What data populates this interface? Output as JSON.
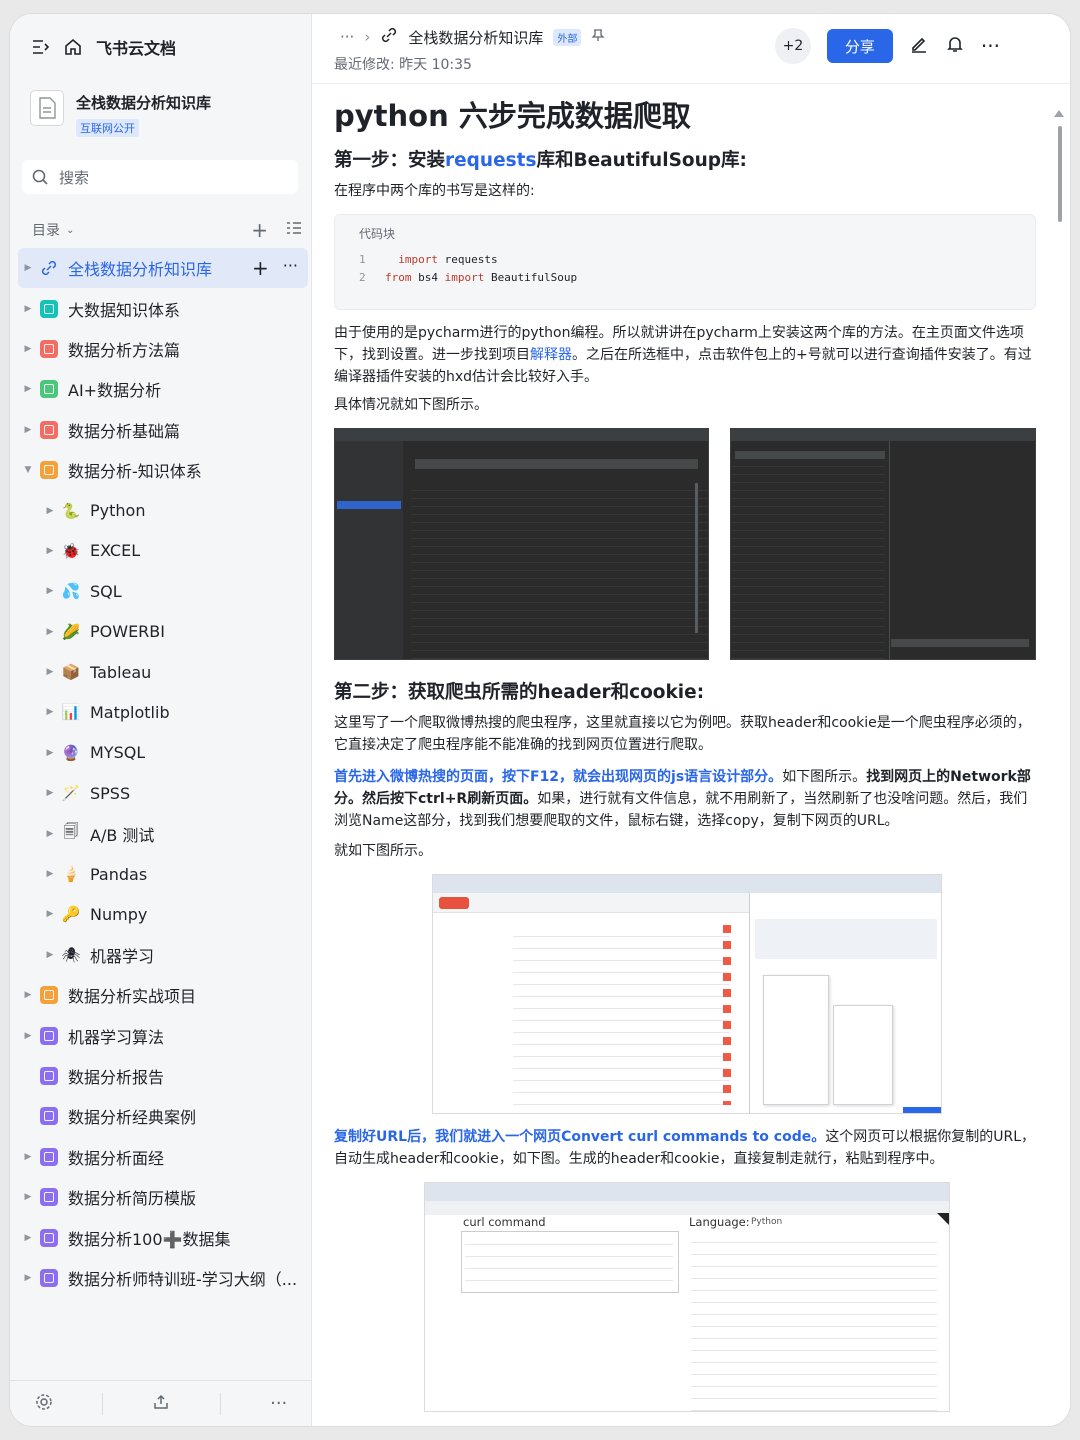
{
  "app": {
    "brand": "飞书云文档"
  },
  "wiki": {
    "title": "全栈数据分析知识库",
    "visibility": "互联网公开"
  },
  "search": {
    "placeholder": "搜索"
  },
  "toc": {
    "label": "目录",
    "items": [
      {
        "label": "全栈数据分析知识库",
        "icon": "link-icon",
        "active": true
      },
      {
        "label": "大数据知识体系",
        "icon": "teal-doc-icon",
        "color": "#15c2b8"
      },
      {
        "label": "数据分析方法篇",
        "icon": "red-doc-icon",
        "color": "#f26e65"
      },
      {
        "label": "AI+数据分析",
        "icon": "green-doc-icon",
        "color": "#4cc67a"
      },
      {
        "label": "数据分析基础篇",
        "icon": "red-doc-icon",
        "color": "#f26e65"
      },
      {
        "label": "数据分析-知识体系",
        "icon": "orange-doc-icon",
        "color": "#f5a13b",
        "expanded": true
      },
      {
        "label": "Python",
        "icon": "python-emoji",
        "glyph": "🐍",
        "level": 2
      },
      {
        "label": "EXCEL",
        "icon": "ladybug-emoji",
        "glyph": "🐞",
        "level": 2
      },
      {
        "label": "SQL",
        "icon": "droplets-emoji",
        "glyph": "💦",
        "level": 2
      },
      {
        "label": "POWERBI",
        "icon": "corn-emoji",
        "glyph": "🌽",
        "level": 2
      },
      {
        "label": "Tableau",
        "icon": "package-emoji",
        "glyph": "📦",
        "level": 2
      },
      {
        "label": "Matplotlib",
        "icon": "chart-emoji",
        "glyph": "📊",
        "level": 2
      },
      {
        "label": "MYSQL",
        "icon": "crystal-ball-emoji",
        "glyph": "🔮",
        "level": 2
      },
      {
        "label": "SPSS",
        "icon": "wand-emoji",
        "glyph": "🪄",
        "level": 2
      },
      {
        "label": "A/B 测试",
        "icon": "copy-icon",
        "glyph": "🗐",
        "level": 2
      },
      {
        "label": "Pandas",
        "icon": "icecream-emoji",
        "glyph": "🍦",
        "level": 2
      },
      {
        "label": "Numpy",
        "icon": "key-emoji",
        "glyph": "🔑",
        "level": 2
      },
      {
        "label": "机器学习",
        "icon": "spider-emoji",
        "glyph": "🕷",
        "level": 2
      },
      {
        "label": "数据分析实战项目",
        "icon": "orange-doc-icon",
        "color": "#f5a13b"
      },
      {
        "label": "机器学习算法",
        "icon": "purple-doc-icon",
        "color": "#8c6ff0"
      },
      {
        "label": "数据分析报告",
        "icon": "purple-doc-icon",
        "color": "#8c6ff0",
        "no_caret": true
      },
      {
        "label": "数据分析经典案例",
        "icon": "purple-doc-icon",
        "color": "#8c6ff0",
        "no_caret": true
      },
      {
        "label": "数据分析面经",
        "icon": "purple-doc-icon",
        "color": "#8c6ff0"
      },
      {
        "label": "数据分析简历模版",
        "icon": "purple-doc-icon",
        "color": "#8c6ff0"
      },
      {
        "label": "数据分析100➕数据集",
        "icon": "purple-doc-icon",
        "color": "#8c6ff0"
      },
      {
        "label": "数据分析师特训班-学习大纲（...",
        "icon": "purple-clock-icon",
        "color": "#8c6ff0"
      }
    ]
  },
  "topbar": {
    "ellipsis": "···",
    "doc_title": "全栈数据分析知识库",
    "external_tag": "外部",
    "modified": "最近修改: 昨天 10:35",
    "collaborators": "+2",
    "share": "分享"
  },
  "doc": {
    "title": "python 六步完成数据爬取",
    "step1": {
      "prefix": "第一步：安装",
      "link": "requests",
      "suffix": "库和BeautifulSoup库:"
    },
    "p1": "在程序中两个库的书写是这样的:",
    "code": {
      "title": "代码块",
      "lines": [
        {
          "n": "1",
          "kw": "import",
          "rest": " requests",
          "indent": "  "
        },
        {
          "n": "2",
          "kw1": "from",
          "mid": " bs4 ",
          "kw2": "import",
          "rest": " BeautifulSoup"
        }
      ]
    },
    "p2a": "由于使用的是pycharm进行的python编程。所以就讲讲在pycharm上安装这两个库的方法。在主页面文件选项下，找到设置。进一步找到项目",
    "p2link": "解释器",
    "p2b": "。之后在所选框中，点击软件包上的+号就可以进行查询插件安装了。有过编译器插件安装的hxd估计会比较好入手。",
    "p3": "具体情况就如下图所示。",
    "step2": "第二步：获取爬虫所需的header和cookie:",
    "p4": "这里写了一个爬取微博热搜的爬虫程序，这里就直接以它为例吧。获取header和cookie是一个爬虫程序必须的，它直接决定了爬虫程序能不能准确的找到网页位置进行爬取。",
    "p5a": "首先进入微博热搜的页面，按下F12，就会出现网页的js语言设计部分。",
    "p5b": "如下图所示。",
    "p5c": "找到网页上的Network部分。然后按下ctrl+R刷新页面。",
    "p5d": "如果，进行就有文件信息，就不用刷新了，当然刷新了也没啥问题。然后，我们浏览Name这部分，找到我们想要爬取的文件，鼠标右键，选择copy，复制下网页的URL。",
    "p6": "就如下图所示。",
    "p7a": "复制好URL后，我们就进入一个网页Convert curl commands to code。",
    "p7b": "这个网页可以根据你复制的URL，自动生成header和cookie，如下图。生成的header和cookie，直接复制走就行，粘贴到程序中。",
    "shot3": {
      "left_title": "curl command",
      "lang_label": "Language:",
      "lang_value": "Python"
    }
  },
  "colors": {
    "accent": "#2a66e8",
    "sidebar_bg": "#f5f6f7",
    "active_bg": "#e1e8f7"
  }
}
